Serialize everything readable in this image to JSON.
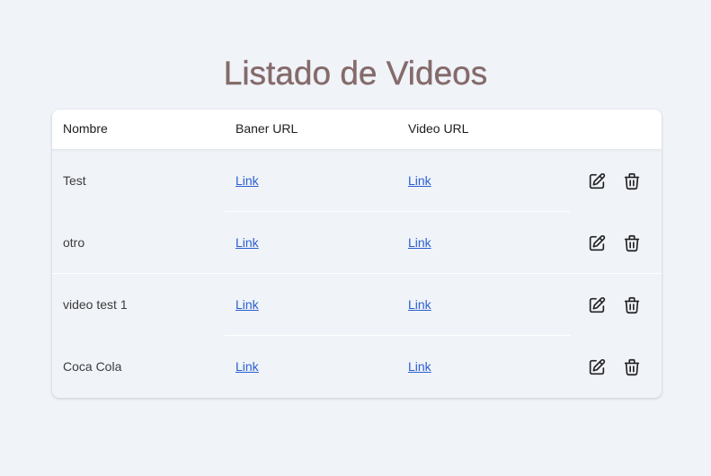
{
  "page": {
    "title": "Listado de Videos"
  },
  "table": {
    "headers": {
      "name": "Nombre",
      "banner_url": "Baner URL",
      "video_url": "Video URL"
    },
    "rows": [
      {
        "name": "Test",
        "banner_link": "Link",
        "video_link": "Link"
      },
      {
        "name": "otro",
        "banner_link": "Link",
        "video_link": "Link"
      },
      {
        "name": "video test 1",
        "banner_link": "Link",
        "video_link": "Link"
      },
      {
        "name": "Coca Cola",
        "banner_link": "Link",
        "video_link": "Link"
      }
    ],
    "row_actions": {
      "edit_icon": "edit-icon",
      "delete_icon": "trash-icon"
    }
  },
  "colors": {
    "background": "#f0f3f8",
    "title": "#856b6b",
    "link": "#2a5fd0",
    "header_bg": "#ffffff"
  }
}
